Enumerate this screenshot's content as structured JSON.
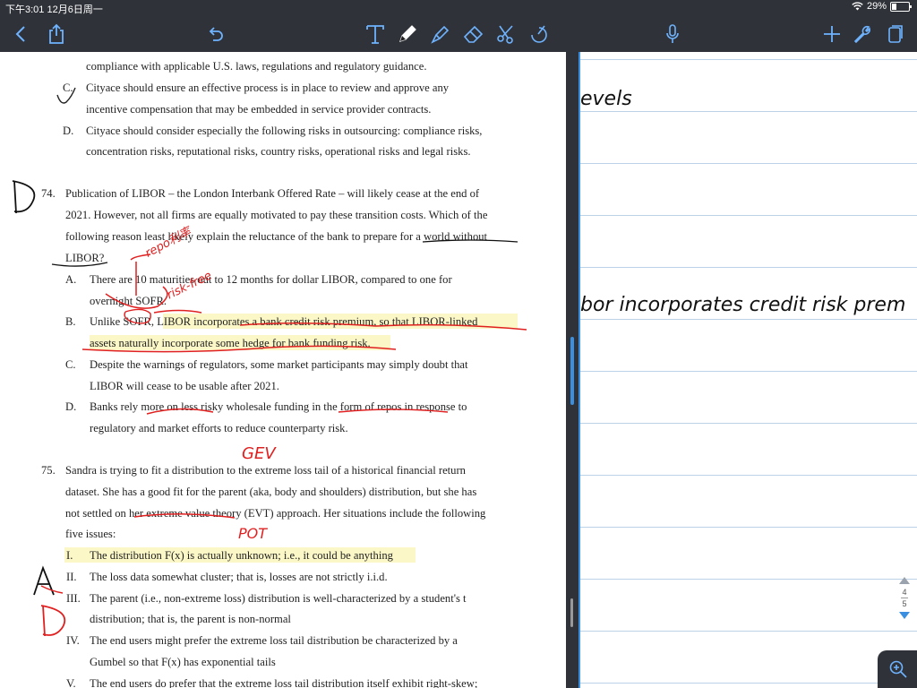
{
  "status": {
    "time": "下午3:01  12月6日周一",
    "battery": "29%"
  },
  "toolbar": {
    "icons": [
      "back-icon",
      "share-icon",
      "undo-icon",
      "text-tool-icon",
      "pen-tool-icon",
      "highlighter-icon",
      "eraser-icon",
      "lasso-icon",
      "shape-tool-icon",
      "microphone-icon",
      "add-page-icon",
      "settings-icon",
      "page-view-icon"
    ]
  },
  "document": {
    "lines": [
      "compliance with applicable U.S. laws, regulations and regulatory guidance.",
      "C.",
      "Cityace should ensure an effective process is in place to review and approve any",
      "incentive compensation that may be embedded in service provider contracts.",
      "D.",
      "Cityace should consider especially the following risks in outsourcing: compliance risks,",
      "concentration risks, reputational risks, country risks, operational risks and legal risks.",
      "74.",
      "Publication of LIBOR – the London Interbank Offered Rate – will likely cease at the end of",
      "2021. However, not all firms are equally motivated to pay these transition costs. Which of the",
      "following reason least likely explain the reluctance of the bank to prepare for a world without",
      "LIBOR?",
      "A.",
      "There are 10 maturities out to 12 months for dollar LIBOR, compared to one for",
      "overnight SOFR.",
      "B.",
      "Unlike SOFR, LIBOR incorporates a bank credit risk premium, so that LIBOR-linked",
      "assets naturally incorporate some hedge for bank funding risk.",
      "C.",
      "Despite the warnings of regulators, some market participants may simply doubt that",
      "LIBOR will cease to be usable after 2021.",
      "D.",
      "Banks rely more on less risky wholesale funding in the form of repos in response to",
      "regulatory and market efforts to reduce counterparty risk.",
      "75.",
      "Sandra is trying to fit a distribution to the extreme loss tail of a historical financial return",
      "dataset. She has a good fit for the parent (aka, body and shoulders) distribution, but she has",
      "not settled on her extreme value theory (EVT) approach. Her situations include the following",
      "five issues:",
      "I.",
      "The distribution F(x) is actually unknown; i.e., it could be anything",
      "II.",
      "The loss data somewhat cluster; that is, losses are not strictly i.i.d.",
      "III.",
      "The parent (i.e., non-extreme loss) distribution is well-characterized by a student's t",
      "distribution; that is, the parent is non-normal",
      "IV.",
      "The end users might prefer the extreme loss tail distribution be characterized by a",
      "Gumbel so that F(x) has exponential tails",
      "V.",
      "The end users do prefer that the extreme loss tail distribution itself exhibit right-skew;"
    ],
    "handwriting": [
      "D",
      "repo利率",
      "risk-free",
      "GEV",
      "POT",
      "A",
      "D"
    ]
  },
  "notebook": {
    "handwriting": [
      "evels",
      "bor incorporates credit risk prem"
    ],
    "page_current": "4",
    "page_total": "5"
  }
}
